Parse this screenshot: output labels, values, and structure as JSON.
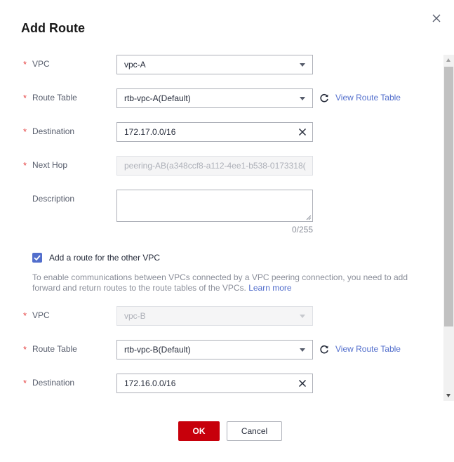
{
  "dialog": {
    "title": "Add Route",
    "required_mark": "*",
    "ok_label": "OK",
    "cancel_label": "Cancel"
  },
  "icons": {
    "close": "close-icon",
    "caret": "chevron-down-icon",
    "clear": "clear-icon",
    "refresh": "refresh-icon",
    "check": "check-icon"
  },
  "colors": {
    "primary_button": "#c7000b",
    "link": "#526ecc",
    "required": "#e64545",
    "checkbox": "#526ecc"
  },
  "local": {
    "vpc_label": "VPC",
    "vpc_value": "vpc-A",
    "route_table_label": "Route Table",
    "route_table_value": "rtb-vpc-A(Default)",
    "view_route_table": "View Route Table",
    "destination_label": "Destination",
    "destination_value": "172.17.0.0/16",
    "next_hop_label": "Next Hop",
    "next_hop_value": "peering-AB(a348ccf8-a112-4ee1-b538-0173318(",
    "description_label": "Description",
    "description_value": "",
    "description_count": "0/255"
  },
  "other_vpc": {
    "checkbox_label": "Add a route for the other VPC",
    "checked": true,
    "hint": "To enable communications between VPCs connected by a VPC peering connection, you need to add forward and return routes to the route tables of the VPCs.",
    "learn_more": "Learn more",
    "vpc_label": "VPC",
    "vpc_value": "vpc-B",
    "route_table_label": "Route Table",
    "route_table_value": "rtb-vpc-B(Default)",
    "view_route_table": "View Route Table",
    "destination_label": "Destination",
    "destination_value": "172.16.0.0/16"
  }
}
